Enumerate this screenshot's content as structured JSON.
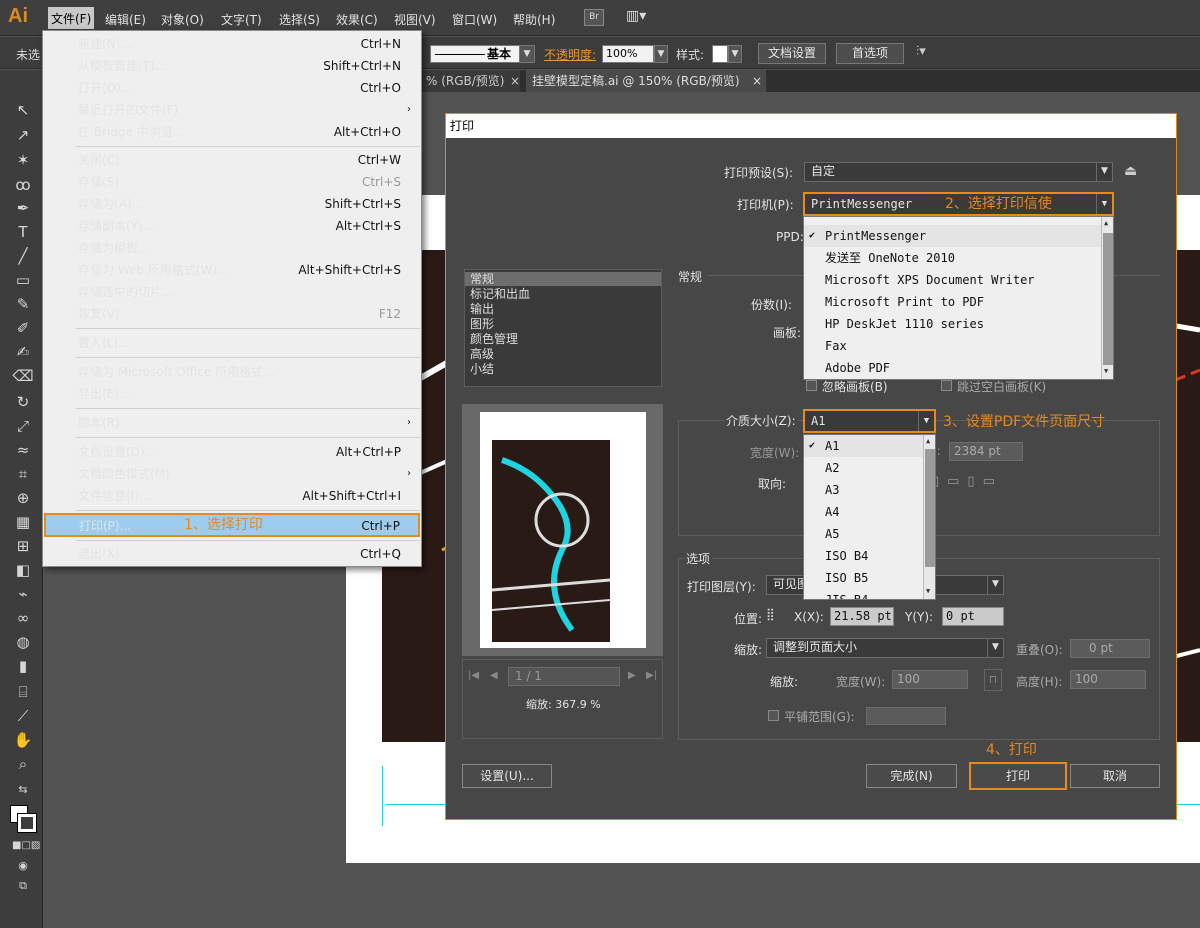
{
  "menubar": {
    "logo": "Ai",
    "items": [
      "文件(F)",
      "编辑(E)",
      "对象(O)",
      "文字(T)",
      "选择(S)",
      "效果(C)",
      "视图(V)",
      "窗口(W)",
      "帮助(H)"
    ],
    "bridge_button": "Br",
    "workspace_icon": "layout-grid-icon"
  },
  "control_bar": {
    "untitled": "未选",
    "stroke_label": "基本",
    "opacity_label": "不透明度:",
    "opacity_value": "100%",
    "style_label": "样式:",
    "doc_setup_button": "文档设置",
    "prefs_button": "首选项",
    "arrange_icon": "arrange-icon"
  },
  "tabs": [
    {
      "label": "% (RGB/预览)",
      "close": "×"
    },
    {
      "label": "挂壁模型定稿.ai @ 150% (RGB/预览)",
      "close": "×"
    }
  ],
  "file_menu": {
    "items": [
      {
        "label": "新建(N)...",
        "shortcut": "Ctrl+N"
      },
      {
        "label": "从模板新建(T)...",
        "shortcut": "Shift+Ctrl+N"
      },
      {
        "label": "打开(O)...",
        "shortcut": "Ctrl+O"
      },
      {
        "label": "最近打开的文件(F)",
        "shortcut": "›"
      },
      {
        "label": "在 Bridge 中浏览...",
        "shortcut": "Alt+Ctrl+O"
      },
      {
        "label": "关闭(C)",
        "shortcut": "Ctrl+W"
      },
      {
        "label": "存储(S)",
        "shortcut": "Ctrl+S"
      },
      {
        "label": "存储为(A)...",
        "shortcut": "Shift+Ctrl+S"
      },
      {
        "label": "存储副本(Y)...",
        "shortcut": "Alt+Ctrl+S"
      },
      {
        "label": "存储为模板...",
        "shortcut": ""
      },
      {
        "label": "存储为 Web 所用格式(W)...",
        "shortcut": "Alt+Shift+Ctrl+S"
      },
      {
        "label": "存储选中的切片...",
        "shortcut": ""
      },
      {
        "label": "恢复(V)",
        "shortcut": "F12"
      },
      {
        "label": "置入(L)...",
        "shortcut": ""
      },
      {
        "label": "存储为 Microsoft Office 所用格式...",
        "shortcut": ""
      },
      {
        "label": "导出(E)...",
        "shortcut": ""
      },
      {
        "label": "脚本(R)",
        "shortcut": "›"
      },
      {
        "label": "文档设置(D)...",
        "shortcut": "Alt+Ctrl+P"
      },
      {
        "label": "文档颜色模式(M)",
        "shortcut": "›"
      },
      {
        "label": "文件信息(I)...",
        "shortcut": "Alt+Shift+Ctrl+I"
      },
      {
        "label": "打印(P)...",
        "shortcut": "Ctrl+P"
      },
      {
        "label": "退出(X)",
        "shortcut": "Ctrl+Q"
      }
    ],
    "print_callout": "1、选择打印"
  },
  "print_dialog": {
    "title": "打印",
    "preset_label": "打印预设(S):",
    "preset_value": "自定",
    "printer_label": "打印机(P):",
    "printer_value": "PrintMessenger",
    "printer_callout": "2、选择打印信使",
    "ppd_label": "PPD:",
    "printer_options": [
      "PrintMessenger",
      "发送至 OneNote 2010",
      "Microsoft XPS Document Writer",
      "Microsoft Print to PDF",
      "HP DeskJet 1110 series",
      "Fax",
      "Adobe PDF"
    ],
    "categories": [
      "常规",
      "标记和出血",
      "输出",
      "图形",
      "颜色管理",
      "高级",
      "小结"
    ],
    "general_heading": "常规",
    "copies_label": "份数(I):",
    "artboard_label": "画板:",
    "ignore_artboards": "忽略画板(B)",
    "skip_blank": "跳过空白画板(K)",
    "media_label": "介质大小(Z):",
    "media_value": "A1",
    "media_callout": "3、设置PDF文件页面尺寸",
    "media_options": [
      "A1",
      "A2",
      "A3",
      "A4",
      "A5",
      "ISO B4",
      "ISO B5",
      "JIS B4"
    ],
    "width_label": "宽度(W):",
    "height_value": "2384 pt",
    "orientation_label": "取向:",
    "options_heading": "选项",
    "print_layers_label": "打印图层(Y):",
    "print_layers_value": "可见图",
    "position_label": "位置:",
    "x_label": "X(X):",
    "x_value": "21.58 pt",
    "y_label": "Y(Y):",
    "y_value": "0 pt",
    "scale_label": "缩放:",
    "scale_value": "调整到页面大小",
    "overlap_label": "重叠(O):",
    "overlap_value": "0 pt",
    "scale2_label": "缩放:",
    "scale_width_label": "宽度(W):",
    "scale_width_value": "100",
    "scale_height_label": "高度(H):",
    "scale_height_value": "100",
    "tile_label": "平铺范围(G):",
    "page_nav": "1 / 1",
    "preview_zoom": "缩放: 367.9 %",
    "setup_button": "设置(U)...",
    "done_button": "完成(N)",
    "print_button": "打印",
    "print_callout": "4、打印",
    "cancel_button": "取消"
  },
  "colors": {
    "accent": "#e8891c",
    "menu_highlight": "#9dcdee",
    "cyan": "#1fd3e0"
  }
}
